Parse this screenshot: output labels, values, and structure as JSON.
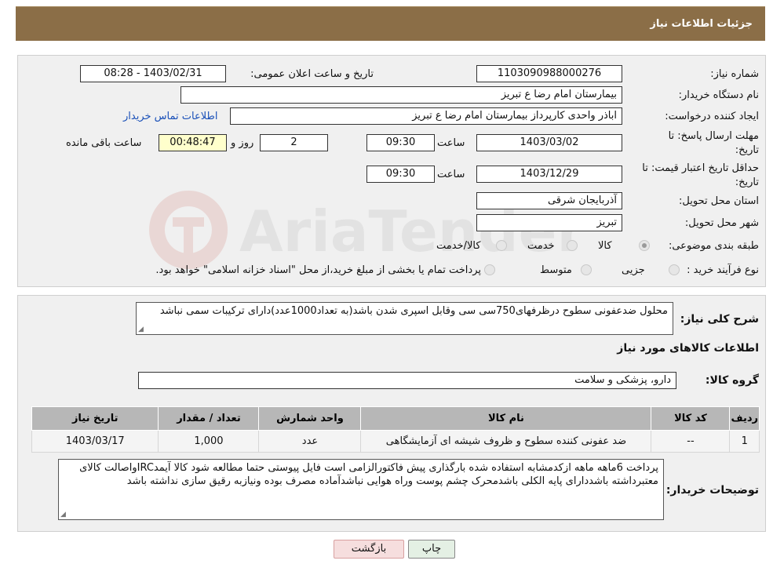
{
  "header": {
    "title": "جزئیات اطلاعات نیاز"
  },
  "fields": {
    "need_number_label": "شماره نیاز:",
    "need_number": "1103090988000276",
    "announce_label": "تاریخ و ساعت اعلان عمومی:",
    "announce_value": "1403/02/31 - 08:28",
    "buyer_label": "نام دستگاه خریدار:",
    "buyer_value": "بیمارستان امام رضا  ع  تبریز",
    "creator_label": "ایجاد کننده درخواست:",
    "creator_value": "اباذر واحدی کارپرداز بیمارستان امام رضا  ع  تبریز",
    "contact_link": "اطلاعات تماس خریدار",
    "deadline_label_1": "مهلت ارسال پاسخ: تا",
    "deadline_label_2": "تاریخ:",
    "deadline_date": "1403/03/02",
    "time_label": "ساعت",
    "deadline_time": "09:30",
    "days_value": "2",
    "days_label": "روز و",
    "remaining_time": "00:48:47",
    "remaining_label": "ساعت باقی مانده",
    "validity_label_1": "حداقل تاریخ اعتبار قیمت: تا",
    "validity_label_2": "تاریخ:",
    "validity_date": "1403/12/29",
    "validity_time": "09:30",
    "province_label": "استان محل تحویل:",
    "province_value": "آذربایجان شرقی",
    "city_label": "شهر محل تحویل:",
    "city_value": "تبریز",
    "category_label": "طبقه بندی موضوعی:",
    "category_options": [
      "کالا",
      "خدمت",
      "کالا/خدمت"
    ],
    "process_label": "نوع فرآیند خرید :",
    "process_options": [
      "جزیی",
      "متوسط"
    ],
    "payment_note": "پرداخت تمام یا بخشی از مبلغ خرید،از محل \"اسناد خزانه اسلامی\" خواهد بود."
  },
  "summary": {
    "label": "شرح کلی نیاز:",
    "value": "محلول ضدعفونی سطوح درظرفهای750سی سی وقابل اسپری شدن باشد(به تعداد1000عدد)دارای ترکیبات سمی نباشد"
  },
  "goods": {
    "section_title": "اطلاعات کالاهای مورد نیاز",
    "group_label": "گروه کالا:",
    "group_value": "دارو، پزشکی و سلامت",
    "columns": [
      "ردیف",
      "کد کالا",
      "نام کالا",
      "واحد شمارش",
      "تعداد / مقدار",
      "تاریخ نیاز"
    ],
    "rows": [
      [
        "1",
        "--",
        "ضد عفونی کننده سطوح و ظروف شیشه ای آزمایشگاهی",
        "عدد",
        "1,000",
        "1403/03/17"
      ]
    ]
  },
  "buyer_notes": {
    "label": "توضیحات خریدار:",
    "value": "پرداخت 6ماهه ماهه ازکدمشابه استفاده شده بارگذاری پیش فاکتورالزامی است فایل پیوستی حتما مطالعه شود کالا آیمدIRCواصالت کالای معتبرداشته باشددارای پایه الکلی باشدمحرک چشم پوست وراه هوایی نباشدآماده مصرف بوده ونیازبه رقیق سازی نداشته باشد"
  },
  "buttons": {
    "print": "چاپ",
    "back": "بازگشت"
  },
  "watermark": {
    "text": "AriaTender.neT"
  },
  "colors": {
    "header_bg": "#8b6e47",
    "link": "#1a50b8",
    "table_header": "#b7b7b7"
  }
}
